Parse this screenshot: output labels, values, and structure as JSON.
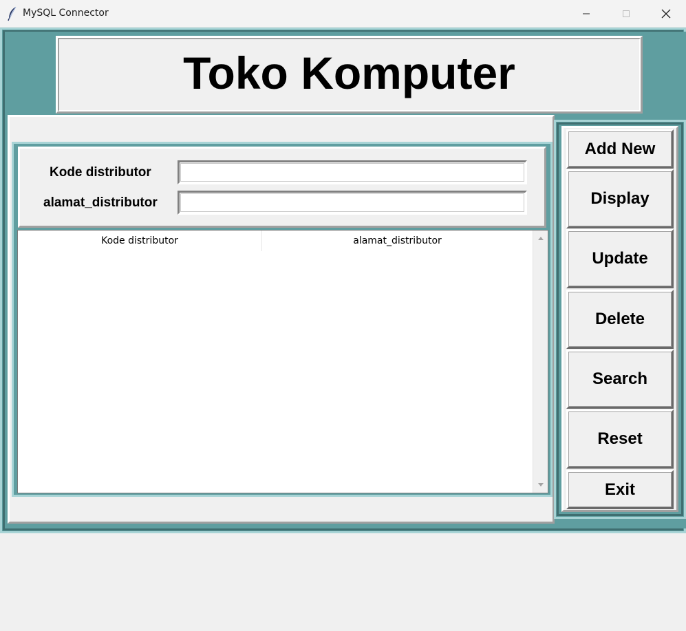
{
  "window": {
    "title": "MySQL Connector",
    "icon": "feather-icon"
  },
  "header": {
    "title": "Toko Komputer"
  },
  "form": {
    "kode_label": "Kode distributor",
    "kode_value": "",
    "alamat_label": "alamat_distributor",
    "alamat_value": ""
  },
  "table": {
    "columns": [
      "Kode distributor",
      "alamat_distributor"
    ],
    "rows": []
  },
  "buttons": {
    "add": "Add New",
    "display": "Display",
    "update": "Update",
    "delete": "Delete",
    "search": "Search",
    "reset": "Reset",
    "exit": "Exit"
  },
  "colors": {
    "frame_teal": "#5f9ea0",
    "panel_gray": "#f0f0f0"
  }
}
